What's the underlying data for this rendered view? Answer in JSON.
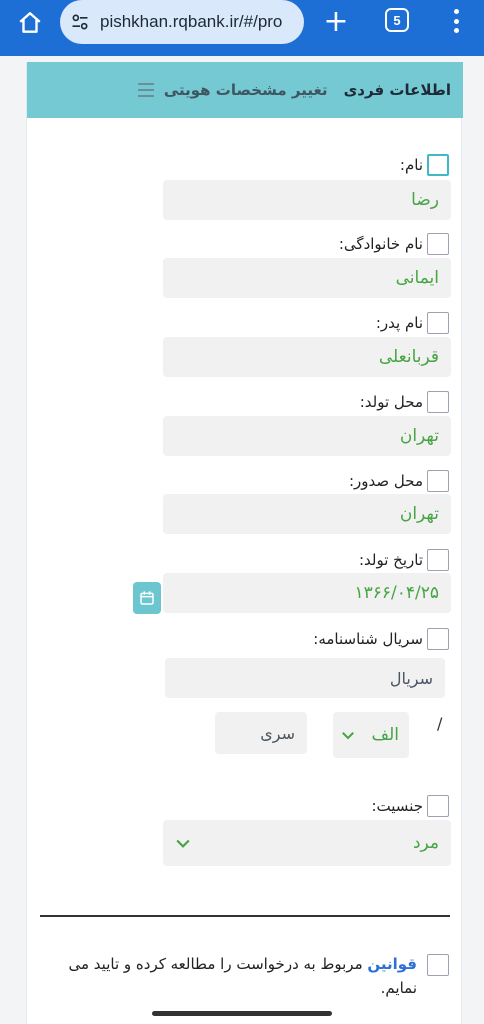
{
  "browser": {
    "url": "pishkhan.rqbank.ir/#/pro",
    "tab_count": "5"
  },
  "card": {
    "title": "اطلاعات فردی",
    "subtitle": "تغییر مشخصات هویتی"
  },
  "fields": {
    "first_name": {
      "label": "نام:",
      "value": "رضا"
    },
    "last_name": {
      "label": "نام خانوادگی:",
      "value": "ایمانی"
    },
    "father_name": {
      "label": "نام پدر:",
      "value": "قربانعلی"
    },
    "birth_place": {
      "label": "محل تولد:",
      "value": "تهران"
    },
    "issue_place": {
      "label": "محل صدور:",
      "value": "تهران"
    },
    "birth_date": {
      "label": "تاریخ تولد:",
      "value": "۱۳۶۶/۰۴/۲۵"
    },
    "id_serial": {
      "label": "سریال شناسنامه:",
      "serial_placeholder": "سریال",
      "letter_value": "الف",
      "series_placeholder": "سری",
      "separator": "/"
    },
    "gender": {
      "label": "جنسیت:",
      "value": "مرد"
    }
  },
  "terms": {
    "link_text": "قوانین",
    "text": " مربوط به درخواست را مطالعه کرده و تایید می نمایم."
  },
  "colors": {
    "browser_bar": "#1d6fd6",
    "card_header": "#74c9d3",
    "value_text": "#46a443",
    "link": "#2d6fd6"
  }
}
